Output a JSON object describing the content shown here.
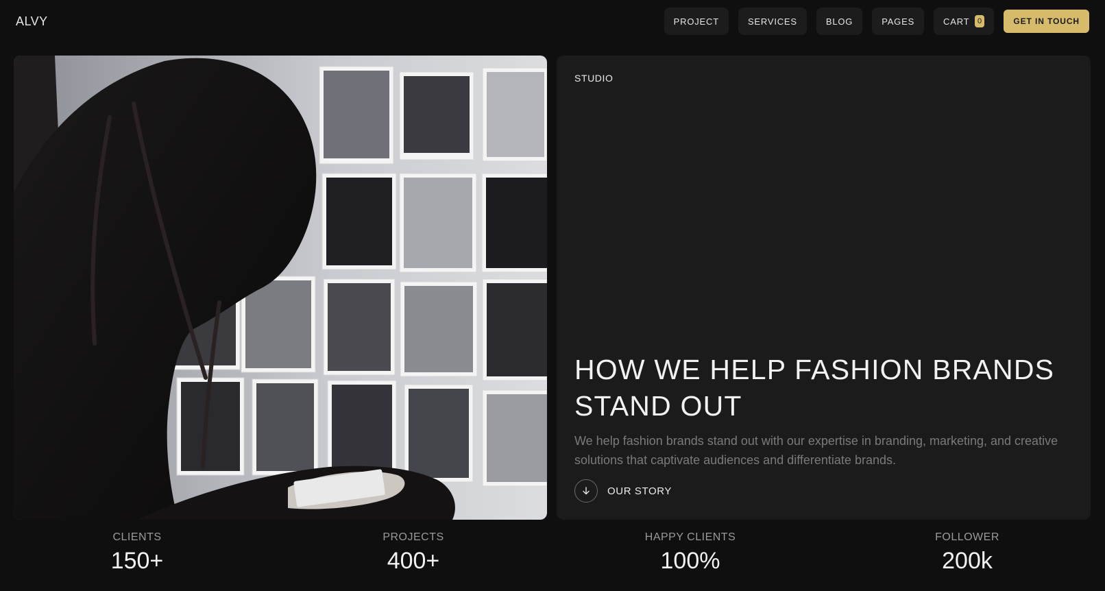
{
  "header": {
    "logo": "ALVY",
    "nav": [
      "PROJECT",
      "SERVICES",
      "BLOG",
      "PAGES"
    ],
    "cart": {
      "label": "CART",
      "count": "0"
    },
    "cta": "GET IN TOUCH"
  },
  "studio": {
    "eyebrow": "STUDIO",
    "title": "HOW WE HELP FASHION BRANDS STAND OUT",
    "description": "We help fashion brands stand out with our expertise in branding, marketing, and creative solutions that captivate audiences and differentiate brands.",
    "link_label": "OUR STORY"
  },
  "stats": [
    {
      "label": "CLIENTS",
      "value": "150+"
    },
    {
      "label": "PROJECTS",
      "value": "400+"
    },
    {
      "label": "HAPPY CLIENTS",
      "value": "100%"
    },
    {
      "label": "FOLLOWER",
      "value": "200k"
    }
  ],
  "colors": {
    "background": "#0f0f0f",
    "panel": "#1b1b1b",
    "accent": "#d6bc6a"
  },
  "icons": {
    "our_story": "arrow-down-icon"
  }
}
